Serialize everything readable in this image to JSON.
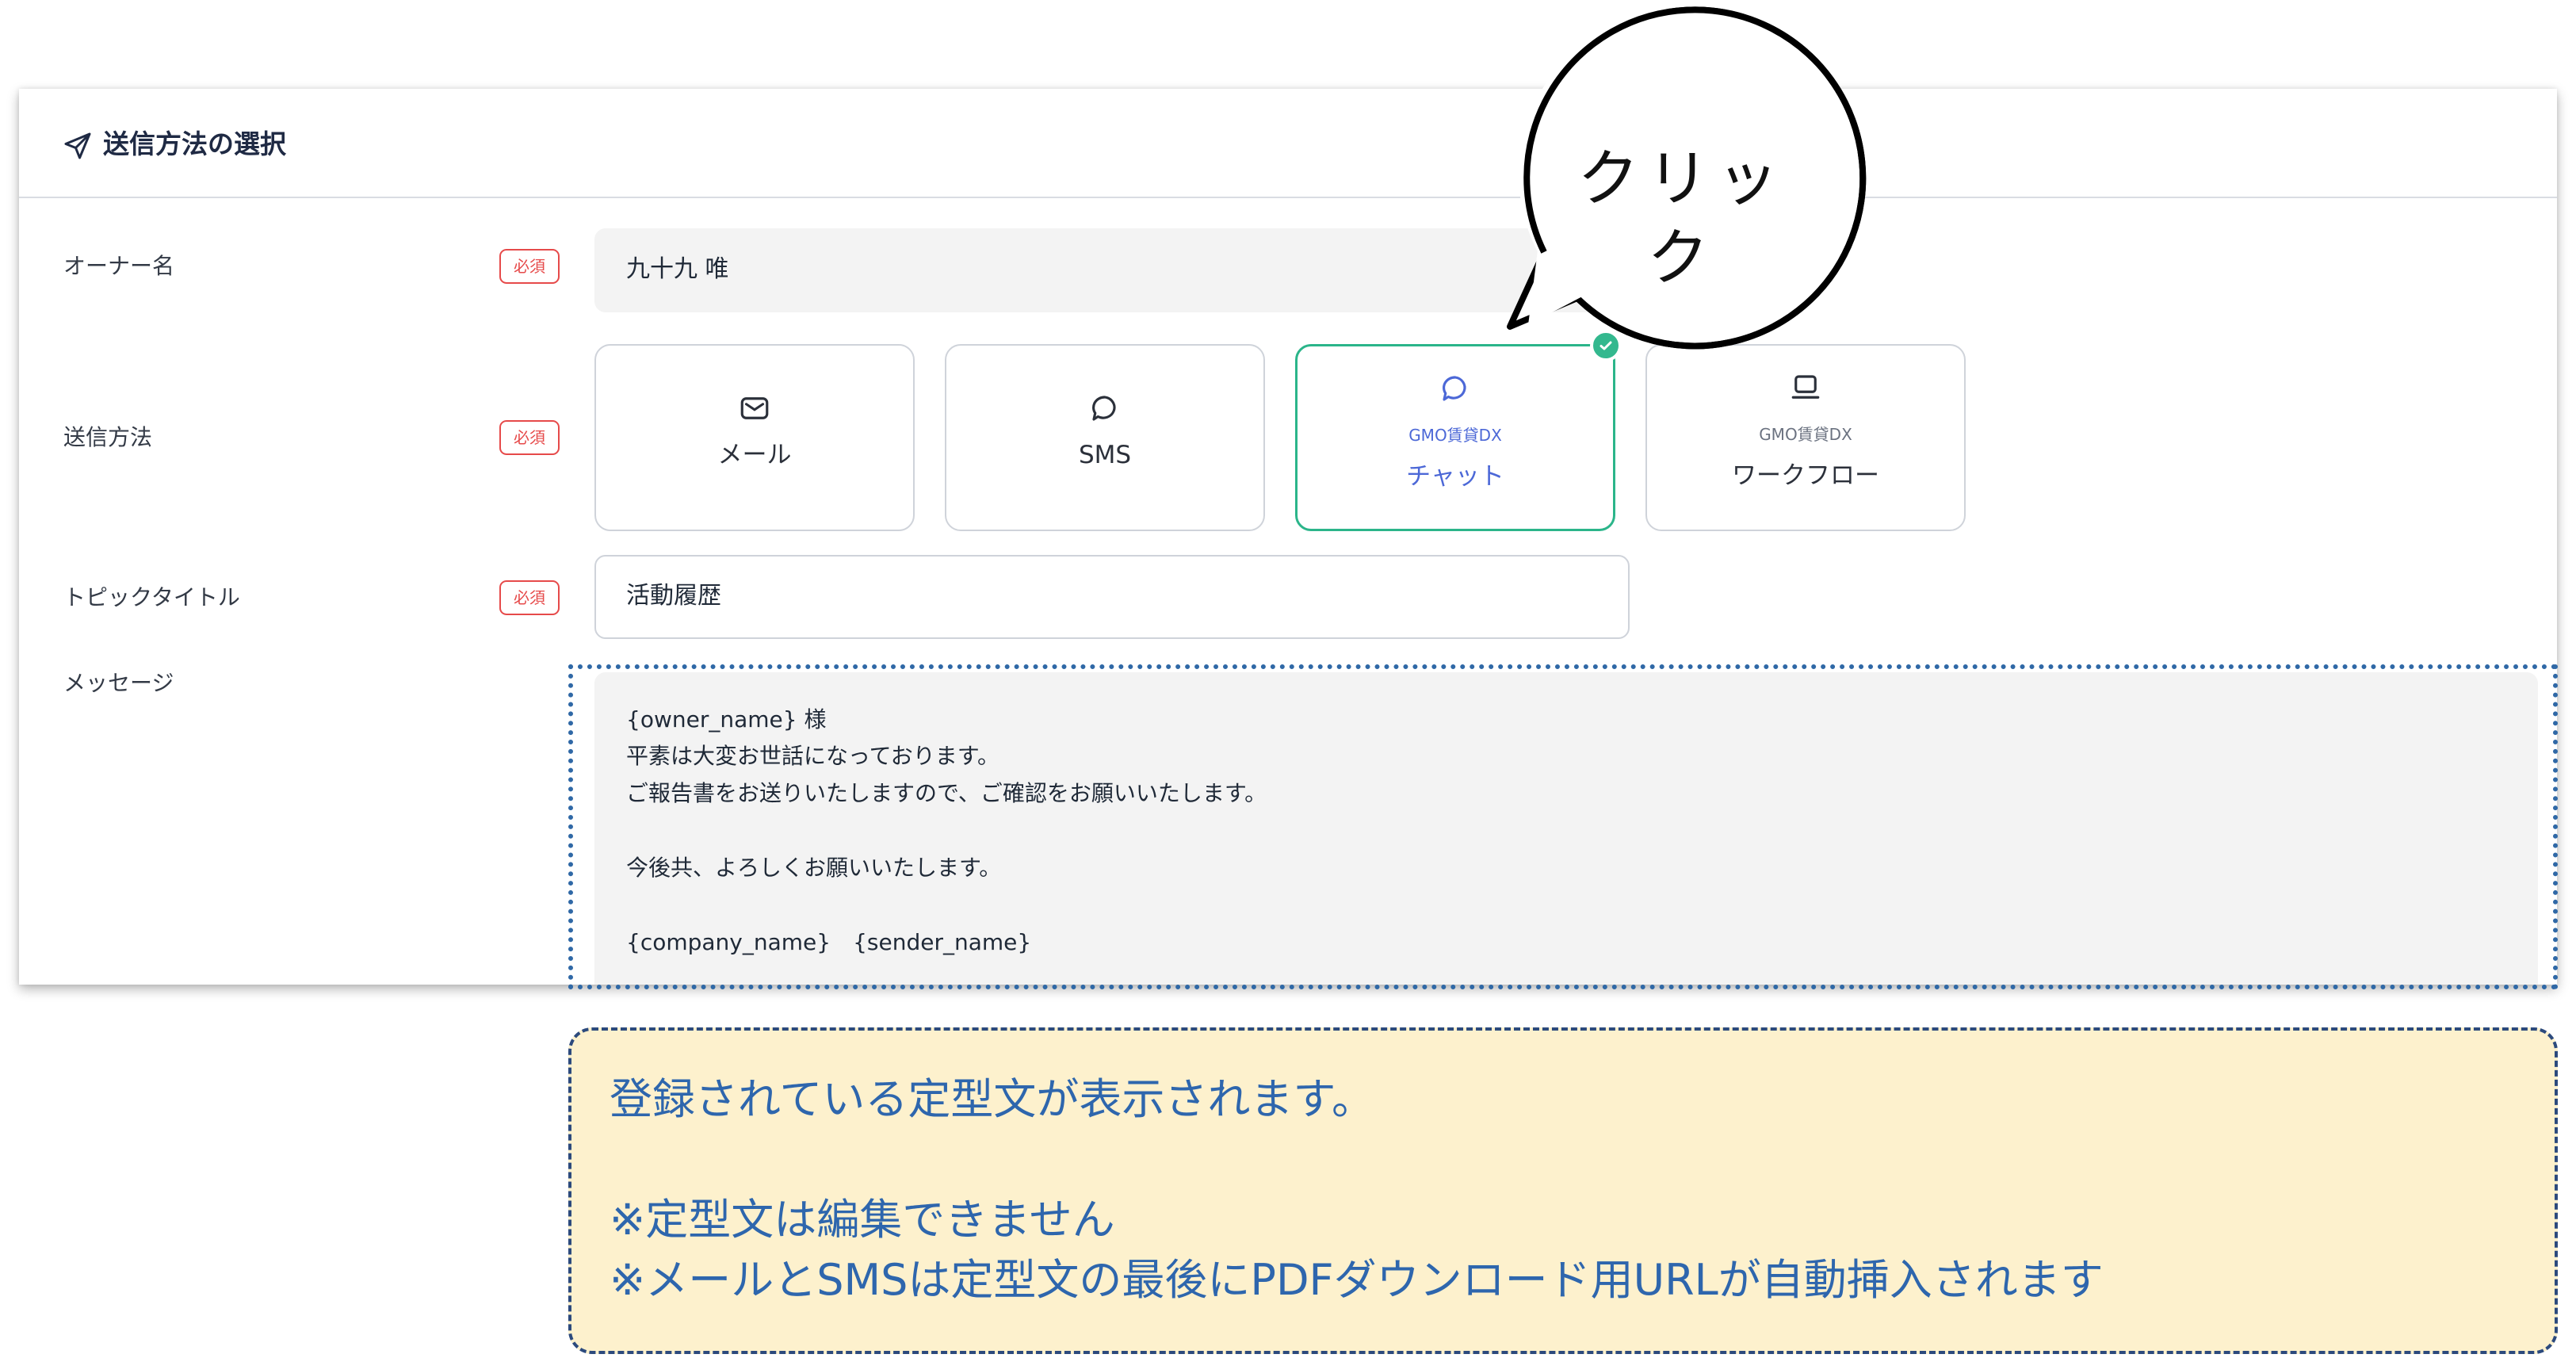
{
  "panel": {
    "title": "送信方法の選択",
    "title_icon": "send-icon"
  },
  "rows": {
    "owner": {
      "label": "オーナー名",
      "badge": "必須",
      "value": "九十九 唯"
    },
    "method": {
      "label": "送信方法",
      "badge": "必須"
    },
    "topic": {
      "label": "トピックタイトル",
      "badge": "必須",
      "value": "活動履歴"
    },
    "message": {
      "label": "メッセージ"
    }
  },
  "methods": [
    {
      "name": "メール",
      "icon": "mail-icon",
      "sub": "",
      "selected": false
    },
    {
      "name": "SMS",
      "icon": "chat-bubble-icon",
      "sub": "",
      "selected": false
    },
    {
      "name": "チャット",
      "icon": "chat-bubble-icon",
      "sub": "GMO賃貸DX",
      "selected": true
    },
    {
      "name": "ワークフロー",
      "icon": "laptop-icon",
      "sub": "GMO賃貸DX",
      "selected": false
    }
  ],
  "message_lines": [
    "{owner_name} 様",
    "平素は大変お世話になっております。",
    "ご報告書をお送りいたしますので、ご確認をお願いいたします。",
    "",
    "今後共、よろしくお願いいたします。",
    "",
    "{company_name}　{sender_name}"
  ],
  "callout": {
    "text": "クリック"
  },
  "note": {
    "lines": [
      "登録されている定型文が表示されます。",
      "",
      "※定型文は編集できません",
      "※メールとSMSは定型文の最後にPDFダウンロード用URLが自動挿入されます"
    ]
  },
  "colors": {
    "selected_border": "#2bb58a",
    "selected_text": "#4c68d7",
    "required_badge": "#e64a4a",
    "note_background": "#fdf1cd",
    "note_text": "#2e66ad",
    "dotted_frame": "#2f68a6"
  }
}
